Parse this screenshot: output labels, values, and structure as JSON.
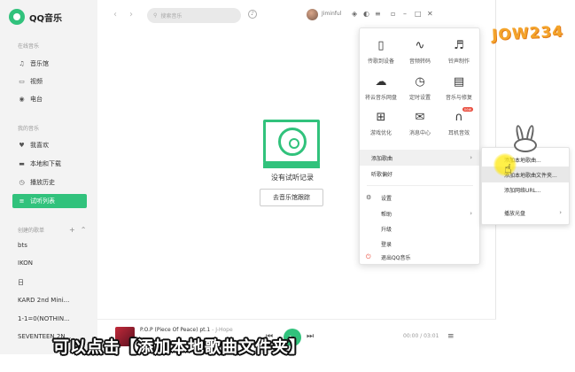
{
  "app": {
    "name": "QQ音乐",
    "brand_color": "#31c27c"
  },
  "sidebar": {
    "section_online": "在线音乐",
    "online_items": [
      {
        "label": "音乐馆",
        "icon": "music-note-icon"
      },
      {
        "label": "视频",
        "icon": "video-icon"
      },
      {
        "label": "电台",
        "icon": "radio-icon"
      }
    ],
    "section_mine": "我的音乐",
    "mine_items": [
      {
        "label": "我喜欢",
        "icon": "heart-icon"
      },
      {
        "label": "本地和下载",
        "icon": "monitor-icon"
      },
      {
        "label": "播放历史",
        "icon": "history-icon"
      },
      {
        "label": "试听列表",
        "icon": "list-icon",
        "active": true
      }
    ],
    "section_created": "创建的歌单",
    "playlists": [
      "bts",
      "IKON",
      "日",
      "KARD 2nd Mini...",
      "1-1=0(NOTHIN...",
      "SEVENTEEN 2N..."
    ]
  },
  "topbar": {
    "search_placeholder": "搜索音乐",
    "username": "Jiminful"
  },
  "main": {
    "empty_text": "没有试听记录",
    "go_button": "去音乐馆跟踪"
  },
  "player": {
    "song": "P.O.P (Piece Of Peace) pt.1",
    "artist": "- J-Hope",
    "time": "00:00 / 03:01"
  },
  "menu": {
    "grid": [
      {
        "label": "传歌到设备",
        "icon": "phone-transfer-icon"
      },
      {
        "label": "音频转码",
        "icon": "audio-wave-icon"
      },
      {
        "label": "铃声制作",
        "icon": "ringtone-icon"
      },
      {
        "label": "将云音乐网盘",
        "icon": "cloud-icon"
      },
      {
        "label": "定时设置",
        "icon": "clock-icon"
      },
      {
        "label": "音乐与修复",
        "icon": "repair-icon"
      },
      {
        "label": "游戏优化",
        "icon": "gamepad-icon"
      },
      {
        "label": "消息中心",
        "icon": "mail-icon"
      },
      {
        "label": "耳机音效",
        "icon": "earphone-icon",
        "badge": "new"
      }
    ],
    "rows": [
      {
        "label": "添加歌曲",
        "has_arrow": true,
        "highlight": true
      },
      {
        "label": "听歌偏好",
        "has_arrow": false
      },
      {
        "label": "设置",
        "icon": "gear-icon"
      },
      {
        "label": "帮助",
        "has_arrow": true
      },
      {
        "label": "升级"
      },
      {
        "label": "登录"
      },
      {
        "label": "退出QQ音乐",
        "icon": "power-icon"
      }
    ]
  },
  "submenu": {
    "rows": [
      {
        "label": "添加本地歌曲..."
      },
      {
        "label": "添加本地歌曲文件夹...",
        "highlight": true
      },
      {
        "label": "添加网络URL..."
      },
      {
        "label": "播放光盘",
        "has_arrow": true
      }
    ]
  },
  "overlay": {
    "watermark_top": "JOW234",
    "caption": "可以点击【添加本地歌曲文件夹】"
  }
}
